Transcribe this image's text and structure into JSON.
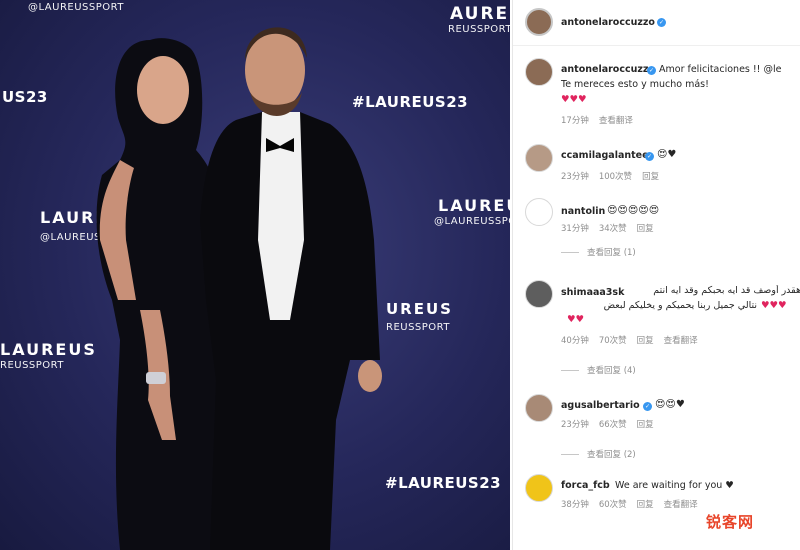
{
  "photo": {
    "wall": {
      "handle": "@LAUREUSSPORT",
      "word": "LAUREUS",
      "word_partial_left": "AUREUS",
      "word_partial_bottom": "UREUS",
      "handle_partial": "REUSSPORT",
      "handle_partial_left": "REUSSPORT",
      "hashtag": "#LAUREUS23",
      "hashtag_partial": "US23",
      "handle_left": "@LAUREUSPORT",
      "word_left": "LAUREUS",
      "word_small": "LAUREUS"
    }
  },
  "header": {
    "username": "antonelaroccuzzo",
    "verified_mark": "✓"
  },
  "comments": [
    {
      "username": "antonelaroccuzzo",
      "text_line1": "Amor felicitaciones !! @le",
      "text_line2": "Te mereces esto y mucho más!",
      "text_line3": "♥♥♥",
      "time": "17分钟",
      "translate": "查看翻译"
    },
    {
      "username": "ccamilagalantee",
      "emojis": "😍♥",
      "time": "23分钟",
      "likes": "100次赞",
      "reply": "回复"
    },
    {
      "username": "nantolin",
      "emojis": "😍😍😍😍😍",
      "time": "31分钟",
      "likes": "34次赞",
      "reply": "回复",
      "view_replies": "查看回复 (1)"
    },
    {
      "username": "shimaaa3sk",
      "text_line1": "هقدر أوصف قد ايه بحبكم وقد ايه انتم",
      "text_line2": "نتالي جميل ربنا يحميكم و يخليكم لبعض",
      "hearts_inline": "♥♥♥",
      "text_line3": "♥♥",
      "time": "40分钟",
      "likes": "70次赞",
      "reply": "回复",
      "translate": "查看翻译",
      "view_replies": "查看回复 (4)"
    },
    {
      "username": "agusalbertario",
      "emojis": "😍😍♥",
      "time": "23分钟",
      "likes": "66次赞",
      "reply": "回复",
      "view_replies": "查看回复 (2)"
    },
    {
      "username": "forca_fcb",
      "text": "We are waiting for you ♥",
      "time": "38分钟",
      "likes": "60次赞",
      "reply": "回复",
      "translate": "查看翻译"
    }
  ],
  "watermark": "锐客网",
  "colors": {
    "heart": "#e0245e",
    "verified": "#3897f0",
    "backdrop": "#25275a"
  }
}
